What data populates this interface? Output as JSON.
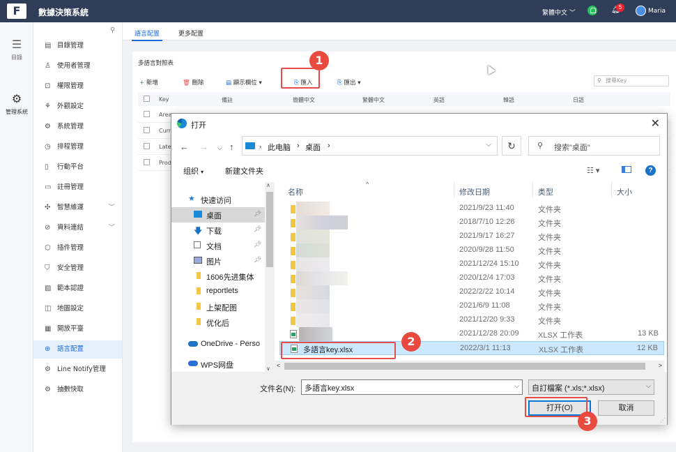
{
  "topbar": {
    "logo": "F",
    "title": "數據決策系統",
    "language": "繁體中文",
    "badge_count": "5",
    "user": "Maria"
  },
  "rail": {
    "items": [
      {
        "label": "目錄",
        "icon": "list-icon"
      },
      {
        "label": "管理系統",
        "icon": "gear-icon"
      }
    ]
  },
  "menu": {
    "items": [
      {
        "label": "目錄管理",
        "icon": "folder-icon"
      },
      {
        "label": "使用者管理",
        "icon": "user-icon"
      },
      {
        "label": "權限管理",
        "icon": "lock-icon"
      },
      {
        "label": "外觀設定",
        "icon": "palette-icon"
      },
      {
        "label": "系統管理",
        "icon": "settings-icon"
      },
      {
        "label": "排程管理",
        "icon": "clock-icon"
      },
      {
        "label": "行動平台",
        "icon": "mobile-icon"
      },
      {
        "label": "註冊管理",
        "icon": "register-icon"
      },
      {
        "label": "智慧維運",
        "icon": "ops-icon"
      },
      {
        "label": "資料連結",
        "icon": "link-icon"
      },
      {
        "label": "插件管理",
        "icon": "plugin-icon"
      },
      {
        "label": "安全管理",
        "icon": "shield-icon"
      },
      {
        "label": "範本認證",
        "icon": "template-icon"
      },
      {
        "label": "地圖設定",
        "icon": "map-icon"
      },
      {
        "label": "開放平臺",
        "icon": "open-icon"
      },
      {
        "label": "語言配置",
        "icon": "globe-icon"
      },
      {
        "label": "Line Notify管理",
        "icon": "line-icon"
      },
      {
        "label": "抽數快取",
        "icon": "cache-icon"
      }
    ]
  },
  "tabs": [
    {
      "label": "語言配置"
    },
    {
      "label": "更多配置"
    }
  ],
  "panel": {
    "title": "多語言對照表",
    "toolbar": {
      "add": "新增",
      "delete": "刪除",
      "show_cols": "顯示欄位",
      "import": "匯入",
      "export": "匯出",
      "search_placeholder": "搜尋Key"
    },
    "columns": [
      "Key",
      "備註",
      "簡體中文",
      "繁體中文",
      "英語",
      "韓語",
      "日語"
    ],
    "rows": [
      "Area",
      "Curren",
      "Latest",
      "Produ"
    ]
  },
  "dialog": {
    "title": "打开",
    "breadcrumb": [
      "此电脑",
      "桌面"
    ],
    "search_placeholder": "搜索\"桌面\"",
    "organize": "组织",
    "new_folder": "新建文件夹",
    "help": "?",
    "nav": [
      {
        "label": "快速访问",
        "icon": "star-icon"
      },
      {
        "label": "桌面",
        "icon": "desktop-icon",
        "pinned": true
      },
      {
        "label": "下载",
        "icon": "download-icon",
        "pinned": true
      },
      {
        "label": "文档",
        "icon": "document-icon",
        "pinned": true
      },
      {
        "label": "图片",
        "icon": "picture-icon",
        "pinned": true
      },
      {
        "label": "1606先进集体",
        "icon": "folder-icon"
      },
      {
        "label": "reportlets",
        "icon": "folder-icon"
      },
      {
        "label": "上架配图",
        "icon": "folder-icon"
      },
      {
        "label": "优化后",
        "icon": "folder-icon"
      },
      {
        "label": "OneDrive - Perso",
        "icon": "cloud-icon"
      },
      {
        "label": "WPS网盘",
        "icon": "cloud-icon"
      }
    ],
    "columns": {
      "name": "名称",
      "modified": "修改日期",
      "type": "类型",
      "size": "大小"
    },
    "files": [
      {
        "name": "",
        "date": "2021/9/23 11:40",
        "type": "文件夹",
        "size": ""
      },
      {
        "name": "",
        "date": "2018/7/10 12:26",
        "type": "文件夹",
        "size": ""
      },
      {
        "name": "",
        "date": "2021/9/17 16:27",
        "type": "文件夹",
        "size": ""
      },
      {
        "name": "",
        "date": "2020/9/28 11:50",
        "type": "文件夹",
        "size": ""
      },
      {
        "name": "",
        "date": "2021/12/24 15:10",
        "type": "文件夹",
        "size": ""
      },
      {
        "name": "",
        "date": "2020/12/4 17:03",
        "type": "文件夹",
        "size": ""
      },
      {
        "name": "",
        "date": "2022/2/22 10:14",
        "type": "文件夹",
        "size": ""
      },
      {
        "name": "",
        "date": "2021/6/9 11:08",
        "type": "文件夹",
        "size": ""
      },
      {
        "name": "",
        "date": "2021/12/20 9:33",
        "type": "文件夹",
        "size": ""
      },
      {
        "name": "",
        "date": "2021/12/28 20:09",
        "type": "XLSX 工作表",
        "size": "13 KB"
      },
      {
        "name": "多語言key.xlsx",
        "date": "2022/3/1 11:13",
        "type": "XLSX 工作表",
        "size": "12 KB"
      }
    ],
    "filename_label": "文件名(N):",
    "filename_value": "多語言key.xlsx",
    "filter": "自訂檔案 (*.xls;*.xlsx)",
    "open_button": "打开(O)",
    "cancel_button": "取消"
  },
  "callouts": [
    "1",
    "2",
    "3"
  ],
  "colors": {
    "accent": "#1c6bd8",
    "topbar": "#2f3d58",
    "callout": "#e94a3f",
    "selection": "#cce8ff"
  }
}
